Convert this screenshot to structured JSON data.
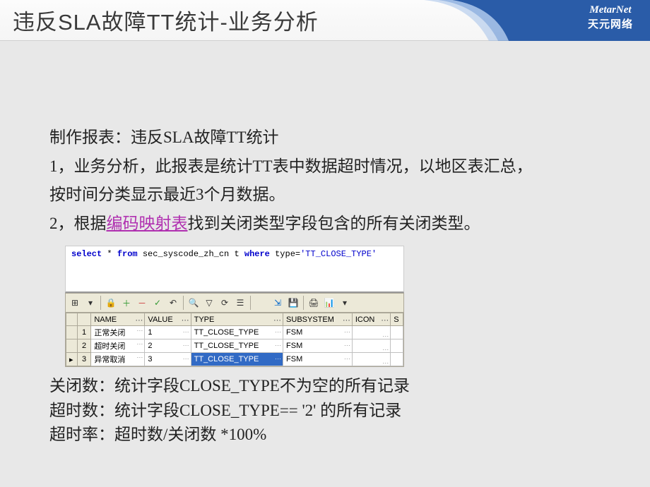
{
  "header": {
    "title": "违反SLA故障TT统计-业务分析",
    "brand_en": "MetarNet",
    "brand_cn": "天元网络"
  },
  "body": {
    "line1": "制作报表：违反SLA故障TT统计",
    "line2a": "1，业务分析，此报表是统计TT表中数据超时情况，以地区表汇总，",
    "line2b": "按时间分类显示最近3个月数据。",
    "line3a": "2，根据",
    "line3_link": "编码映射表",
    "line3b": "找到关闭类型字段包含的所有关闭类型。",
    "sql": {
      "kw1": "select",
      "star": " * ",
      "kw2": "from",
      "table": " sec_syscode_zh_cn t ",
      "kw3": "where",
      "cond": " type=",
      "str": "'TT_CLOSE_TYPE'"
    },
    "grid": {
      "headers": [
        "",
        "",
        "NAME",
        "VALUE",
        "TYPE",
        "SUBSYSTEM",
        "ICON",
        "S"
      ],
      "rows": [
        {
          "num": "1",
          "name": "正常关闭",
          "value": "1",
          "type": "TT_CLOSE_TYPE",
          "sub": "FSM",
          "icon": ""
        },
        {
          "num": "2",
          "name": "超时关闭",
          "value": "2",
          "type": "TT_CLOSE_TYPE",
          "sub": "FSM",
          "icon": ""
        },
        {
          "num": "3",
          "name": "异常取消",
          "value": "3",
          "type": "TT_CLOSE_TYPE",
          "sub": "FSM",
          "icon": "",
          "selected": true
        }
      ]
    },
    "note1": "关闭数：统计字段CLOSE_TYPE不为空的所有记录",
    "note2": "超时数：统计字段CLOSE_TYPE== '2' 的所有记录",
    "note3": "超时率：超时数/关闭数 *100%"
  }
}
